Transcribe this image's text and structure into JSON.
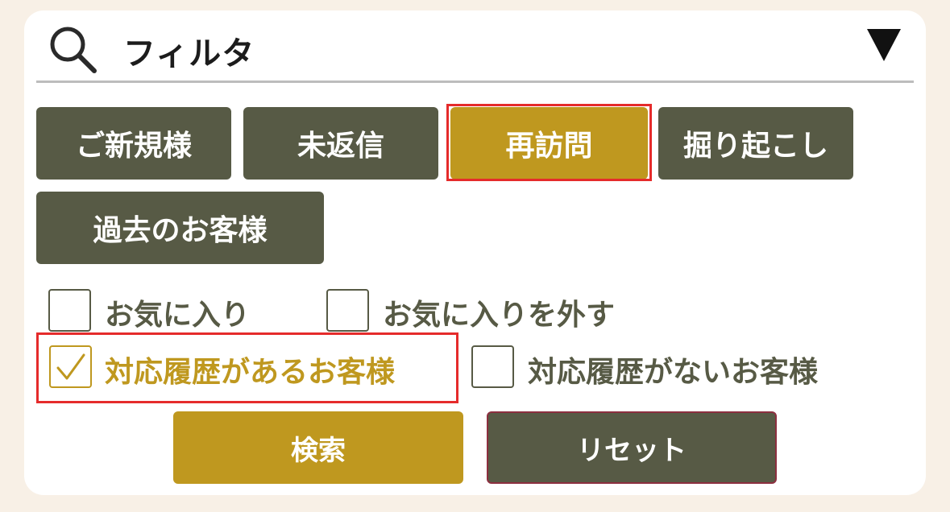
{
  "filter": {
    "title": "フィルタ",
    "icons": {
      "search": "search-icon",
      "toggle": "triangle-down-icon"
    }
  },
  "categories": [
    {
      "label": "ご新規様",
      "selected": false
    },
    {
      "label": "未返信",
      "selected": false
    },
    {
      "label": "再訪問",
      "selected": true
    },
    {
      "label": "掘り起こし",
      "selected": false
    },
    {
      "label": "過去のお客様",
      "selected": false
    }
  ],
  "options": [
    {
      "label": "お気に入り",
      "checked": false
    },
    {
      "label": "お気に入りを外す",
      "checked": false
    },
    {
      "label": "対応履歴があるお客様",
      "checked": true
    },
    {
      "label": "対応履歴がないお客様",
      "checked": false
    }
  ],
  "actions": {
    "search_label": "検索",
    "reset_label": "リセット"
  },
  "colors": {
    "background": "#f8f0e6",
    "chip": "#575a45",
    "accent": "#bf981f",
    "highlight": "#e52b2b"
  }
}
